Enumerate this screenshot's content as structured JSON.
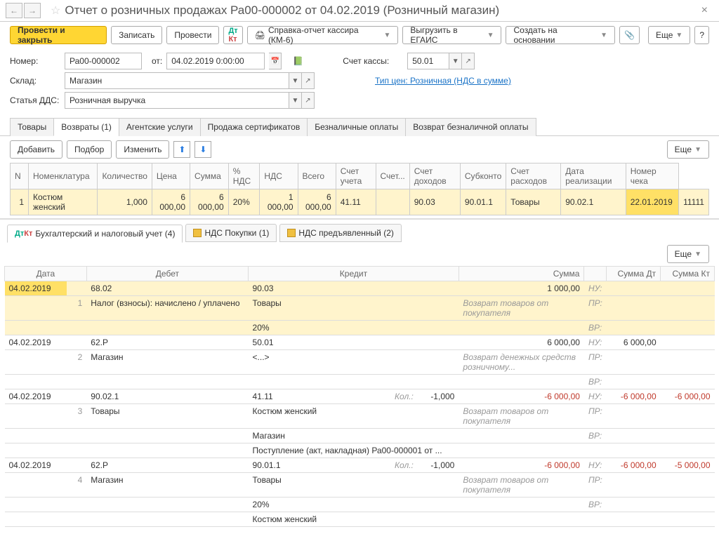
{
  "title": "Отчет о розничных продажах Ра00-000002 от 04.02.2019 (Розничный магазин)",
  "toolbar": {
    "post_close": "Провести и закрыть",
    "save": "Записать",
    "post": "Провести",
    "report_km6": "Справка-отчет кассира (КМ-6)",
    "upload_egais": "Выгрузить в ЕГАИС",
    "create_based": "Создать на основании",
    "more": "Еще",
    "help": "?"
  },
  "form": {
    "number_lbl": "Номер:",
    "number": "Ра00-000002",
    "from_lbl": "от:",
    "date": "04.02.2019  0:00:00",
    "cash_acc_lbl": "Счет кассы:",
    "cash_acc": "50.01",
    "warehouse_lbl": "Склад:",
    "warehouse": "Магазин",
    "price_type_link": "Тип цен: Розничная (НДС в сумме)",
    "dds_lbl": "Статья ДДС:",
    "dds": "Розничная выручка"
  },
  "tabs": [
    "Товары",
    "Возвраты (1)",
    "Агентские услуги",
    "Продажа сертификатов",
    "Безналичные оплаты",
    "Возврат безналичной оплаты"
  ],
  "subtb": {
    "add": "Добавить",
    "pick": "Подбор",
    "edit": "Изменить",
    "more": "Еще"
  },
  "grid": {
    "headers": [
      "N",
      "Номенклатура",
      "Количество",
      "Цена",
      "Сумма",
      "% НДС",
      "НДС",
      "Всего",
      "Счет учета",
      "Счет...",
      "Счет доходов",
      "Субконто",
      "Счет расходов",
      "Дата реализации",
      "Номер чека"
    ],
    "row": {
      "n": "1",
      "name": "Костюм женский",
      "qty": "1,000",
      "price": "6 000,00",
      "sum": "6 000,00",
      "vat_rate": "20%",
      "vat": "1 000,00",
      "total": "6 000,00",
      "acc": "41.11",
      "acc2": "",
      "income": "90.03",
      "sub": "90.01.1",
      "sub2": "Товары",
      "expense": "90.02.1",
      "real_date": "22.01.2019",
      "check": "11111"
    }
  },
  "reg_tabs": [
    "Бухгалтерский и налоговый учет (4)",
    "НДС Покупки (1)",
    "НДС предъявленный (2)"
  ],
  "reg": {
    "headers": [
      "Дата",
      "",
      "Дебет",
      "",
      "Кредит",
      "",
      "",
      "Сумма",
      "",
      "Сумма Дт",
      "Сумма Кт"
    ],
    "rows": [
      {
        "date": "04.02.2019",
        "n": "1",
        "d_acc": "68.02",
        "d_sub": "Налог (взносы): начислено / уплачено",
        "k_acc": "90.03",
        "k_sub": [
          "Товары",
          "20%"
        ],
        "sum": "1 000,00",
        "sum_desc": "Возврат товаров от покупателя",
        "tags": [
          "НУ:",
          "ПР:",
          "ВР:"
        ],
        "dt": "",
        "kt": "",
        "highlight": true
      },
      {
        "date": "04.02.2019",
        "n": "2",
        "d_acc": "62.Р",
        "d_sub": "Магазин",
        "k_acc": "50.01",
        "k_sub": [
          "<...>"
        ],
        "sum": "6 000,00",
        "sum_desc": "Возврат денежных средств розничному...",
        "tags": [
          "НУ:",
          "ПР:",
          "ВР:"
        ],
        "dt": "6 000,00",
        "kt": ""
      },
      {
        "date": "04.02.2019",
        "n": "3",
        "d_acc": "90.02.1",
        "d_sub": "Товары",
        "k_acc": "41.11",
        "k_kol": "Кол.:",
        "k_kol_v": "-1,000",
        "k_sub": [
          "Костюм женский",
          "Магазин",
          "Поступление (акт, накладная) Ра00-000001 от ..."
        ],
        "sum": "-6 000,00",
        "sum_desc": "Возврат товаров от покупателя",
        "tags": [
          "НУ:",
          "ПР:",
          "ВР:"
        ],
        "dt": "-6 000,00",
        "kt": "-6 000,00",
        "neg": true
      },
      {
        "date": "04.02.2019",
        "n": "4",
        "d_acc": "62.Р",
        "d_sub": "Магазин",
        "k_acc": "90.01.1",
        "k_kol": "Кол.:",
        "k_kol_v": "-1,000",
        "k_sub": [
          "Товары",
          "20%",
          "Костюм женский"
        ],
        "sum": "-6 000,00",
        "sum_desc": "Возврат товаров от покупателя",
        "tags": [
          "НУ:",
          "ПР:",
          "ВР:"
        ],
        "dt": "-6 000,00",
        "kt": "-5 000,00",
        "neg": true
      }
    ]
  }
}
